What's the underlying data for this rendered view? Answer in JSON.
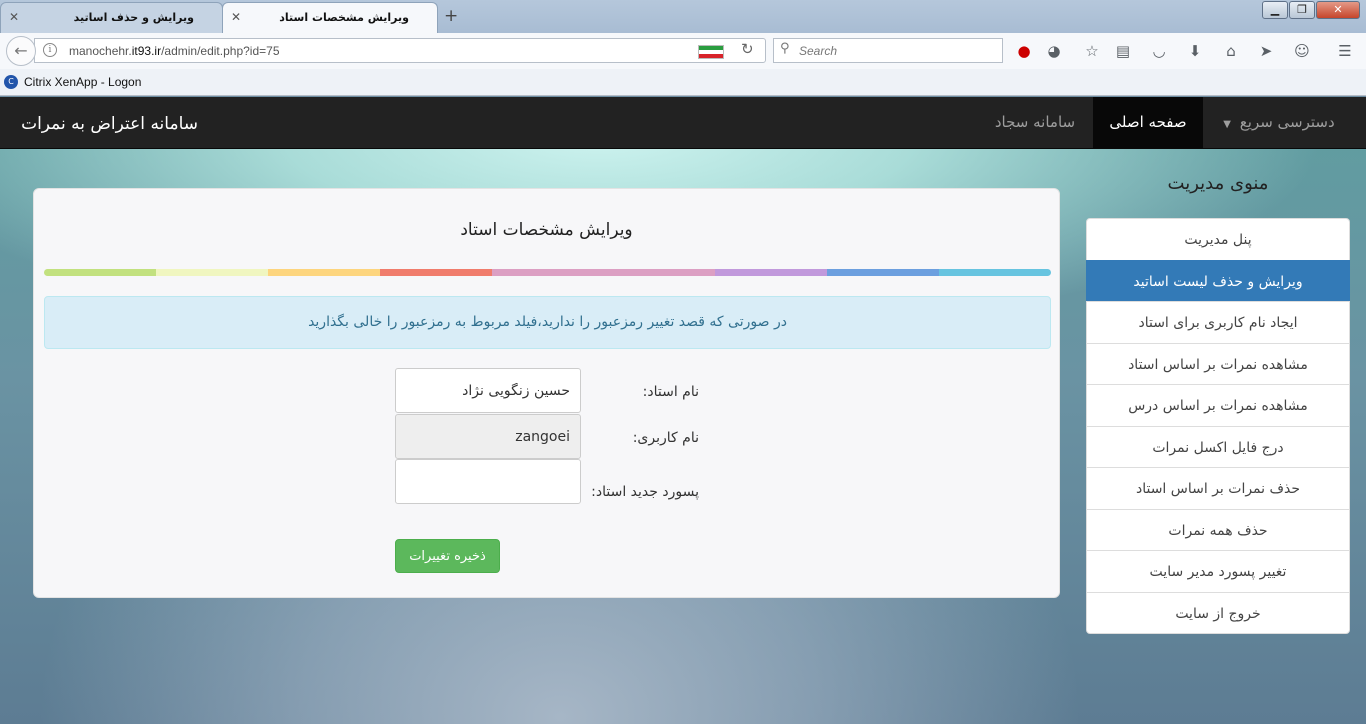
{
  "browser": {
    "tabs": [
      {
        "title": "ویرایش و حذف اساتید",
        "active": false
      },
      {
        "title": "ویرایش مشخصات استاد",
        "active": true
      }
    ],
    "url_prefix": "manochehr.",
    "url_host": "it93.ir",
    "url_path": "/admin/edit.php?id=75",
    "search_placeholder": "Search",
    "bookmarks": [
      {
        "label": "Citrix XenApp - Logon",
        "icon": "citrix-icon"
      }
    ],
    "toolbar_icons": [
      "record-icon",
      "addon-icon",
      "star-icon",
      "reading-list-icon",
      "pocket-icon",
      "download-icon",
      "home-icon",
      "send-icon",
      "smiley-icon",
      "menu-icon"
    ]
  },
  "site": {
    "brand": "سامانه اعتراض به نمرات",
    "nav": {
      "quick_access": "دسترسی سریع",
      "home": "صفحه اصلی",
      "sajad": "سامانه سجاد"
    }
  },
  "form": {
    "title": "ویرایش مشخصات استاد",
    "rainbow_colors": [
      "#c2e17f",
      "#f0f6c0",
      "#fdd57e",
      "#f07c6c",
      "#dc9fc3",
      "#c199dc",
      "#6c9fdf",
      "#67c4e0"
    ],
    "alert": "در صورتی که قصد تغییر رمزعبور را ندارید،فیلد مربوط به رمزعبور را خالی بگذارید",
    "name_label": "نام استاد:",
    "name_value": "حسین زنگویی نژاد",
    "username_label": "نام کاربری:",
    "username_value": "zangoei",
    "password_label": "پسورد جدید استاد:",
    "password_value": "",
    "save_label": "ذخیره تغییرات"
  },
  "sidebar": {
    "title": "منوی مدیریت",
    "items": [
      {
        "label": "پنل مدیریت",
        "active": false
      },
      {
        "label": "ویرایش و حذف لیست اساتید",
        "active": true
      },
      {
        "label": "ایجاد نام کاربری برای استاد",
        "active": false
      },
      {
        "label": "مشاهده نمرات بر اساس استاد",
        "active": false
      },
      {
        "label": "مشاهده نمرات بر اساس درس",
        "active": false
      },
      {
        "label": "درج فایل اکسل نمرات",
        "active": false
      },
      {
        "label": "حذف نمرات بر اساس استاد",
        "active": false
      },
      {
        "label": "حذف همه نمرات",
        "active": false
      },
      {
        "label": "تغییر پسورد مدیر سایت",
        "active": false
      },
      {
        "label": "خروج از سایت",
        "active": false
      }
    ]
  },
  "colors": {
    "navbar_bg": "#222222",
    "active_menu": "#337ab7",
    "save_button": "#5cb85c",
    "alert_bg": "#d9edf7",
    "alert_text": "#31708f"
  }
}
